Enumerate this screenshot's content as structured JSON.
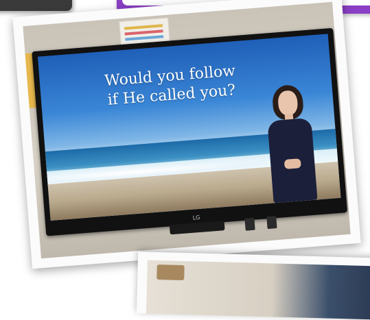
{
  "slide": {
    "line1": "Would you follow",
    "line2": "if He called you?"
  },
  "tv": {
    "brand": "LG"
  },
  "colors": {
    "banner_purple": "#8a3fc4",
    "sky_blue": "#3a86d6",
    "sand": "#b9a98c"
  }
}
